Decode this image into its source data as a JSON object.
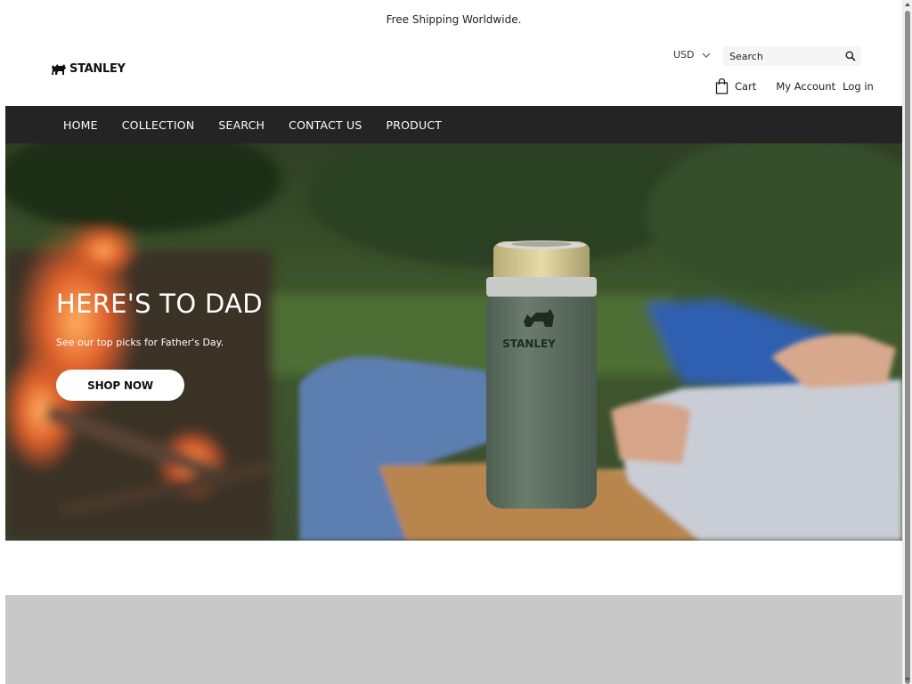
{
  "announcement": {
    "text": "Free Shipping Worldwide."
  },
  "header": {
    "logo": {
      "text": "STANLEY",
      "icon": "stanley-bear-icon"
    },
    "currency": {
      "selected": "USD",
      "icon": "chevron-down-icon"
    },
    "search": {
      "placeholder": "Search",
      "icon": "search-icon"
    },
    "cart": {
      "label": "Cart",
      "icon": "shopping-bag-icon"
    },
    "account": {
      "label": "My Account"
    },
    "login": {
      "label": "Log in"
    }
  },
  "nav": {
    "items": [
      {
        "label": "HOME"
      },
      {
        "label": "COLLECTION"
      },
      {
        "label": "SEARCH"
      },
      {
        "label": "CONTACT US"
      },
      {
        "label": "PRODUCT"
      }
    ]
  },
  "hero": {
    "title": "HERE'S TO DAD",
    "subtitle": "See our top picks for Father's Day.",
    "button_label": "SHOP NOW",
    "can_logo_text": "STANLEY"
  },
  "colors": {
    "nav_background": "#242424",
    "tumbler": "#5f6f63",
    "gray_section": "#c8c8c8"
  }
}
